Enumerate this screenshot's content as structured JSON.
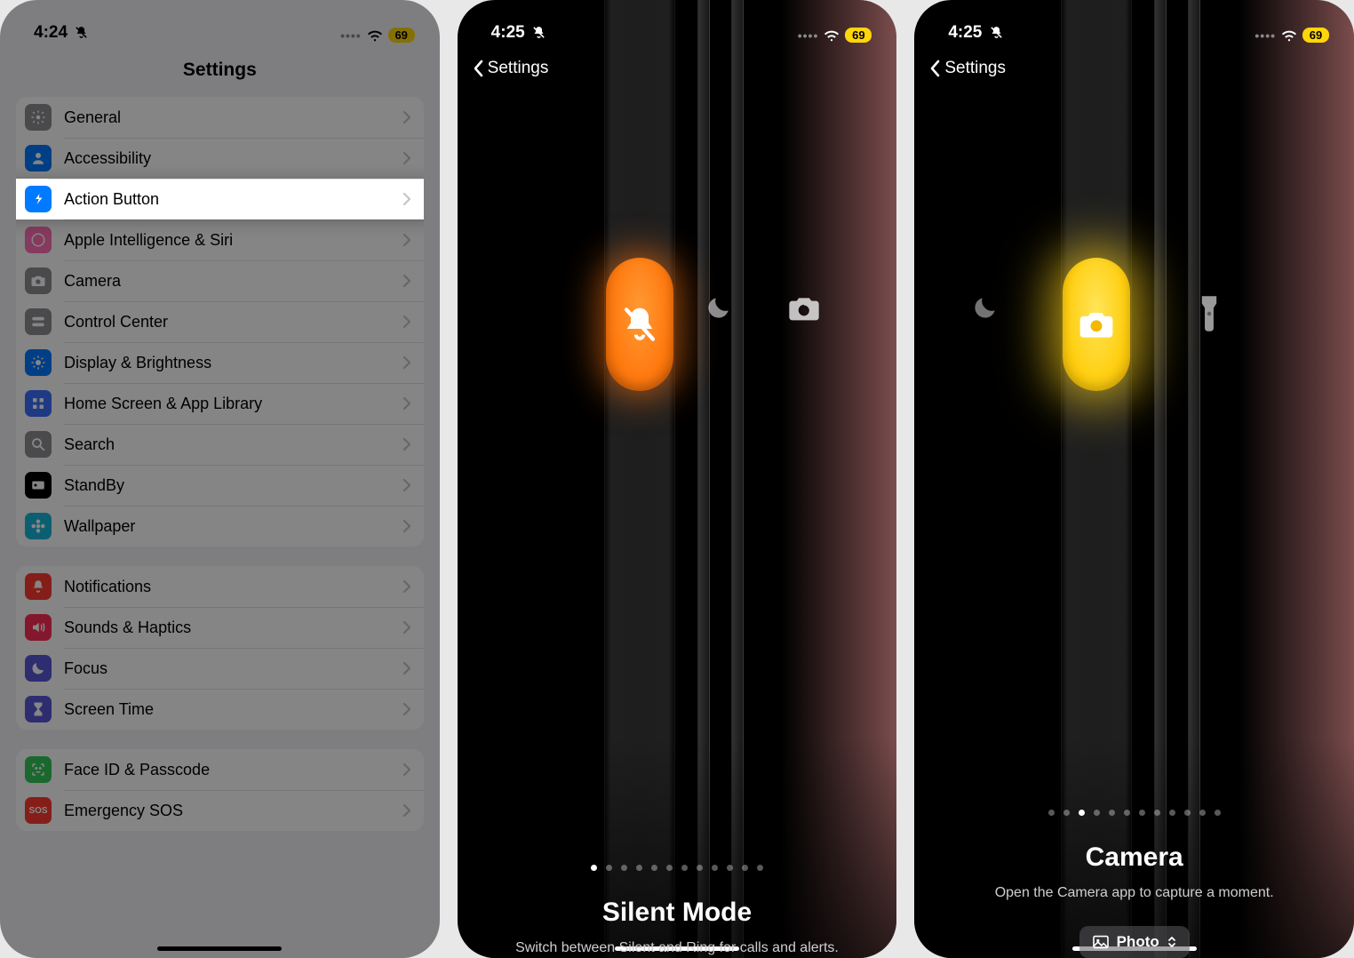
{
  "status": {
    "time1": "4:24",
    "time23": "4:25",
    "battery": "69"
  },
  "settings": {
    "title": "Settings",
    "groups": [
      {
        "rows": [
          {
            "label": "General",
            "color": "#8e8e93",
            "icon": "gear"
          },
          {
            "label": "Accessibility",
            "color": "#007aff",
            "icon": "person"
          },
          {
            "label": "Action Button",
            "color": "#007aff",
            "icon": "action",
            "highlight": true
          },
          {
            "label": "Apple Intelligence & Siri",
            "color": "#ff6fb4",
            "icon": "siri"
          },
          {
            "label": "Camera",
            "color": "#8e8e93",
            "icon": "camera"
          },
          {
            "label": "Control Center",
            "color": "#8e8e93",
            "icon": "switches"
          },
          {
            "label": "Display & Brightness",
            "color": "#007aff",
            "icon": "sun"
          },
          {
            "label": "Home Screen & App Library",
            "color": "#3a6fff",
            "icon": "grid"
          },
          {
            "label": "Search",
            "color": "#8e8e93",
            "icon": "search"
          },
          {
            "label": "StandBy",
            "color": "#000000",
            "icon": "standby"
          },
          {
            "label": "Wallpaper",
            "color": "#17b6d8",
            "icon": "flower"
          }
        ]
      },
      {
        "rows": [
          {
            "label": "Notifications",
            "color": "#ff3b30",
            "icon": "bell"
          },
          {
            "label": "Sounds & Haptics",
            "color": "#ff2d55",
            "icon": "speaker"
          },
          {
            "label": "Focus",
            "color": "#5856d6",
            "icon": "moon"
          },
          {
            "label": "Screen Time",
            "color": "#5856d6",
            "icon": "hourglass"
          }
        ]
      },
      {
        "rows": [
          {
            "label": "Face ID & Passcode",
            "color": "#34c759",
            "icon": "face"
          },
          {
            "label": "Emergency SOS",
            "color": "#ff3b30",
            "icon": "sos"
          }
        ]
      }
    ]
  },
  "screen2": {
    "back": "Settings",
    "title": "Silent Mode",
    "desc": "Switch between Silent and Ring for calls and alerts.",
    "dots": 12,
    "active_dot": 0
  },
  "screen3": {
    "back": "Settings",
    "title": "Camera",
    "desc": "Open the Camera app to capture a moment.",
    "option": "Photo",
    "dots": 12,
    "active_dot": 2
  }
}
